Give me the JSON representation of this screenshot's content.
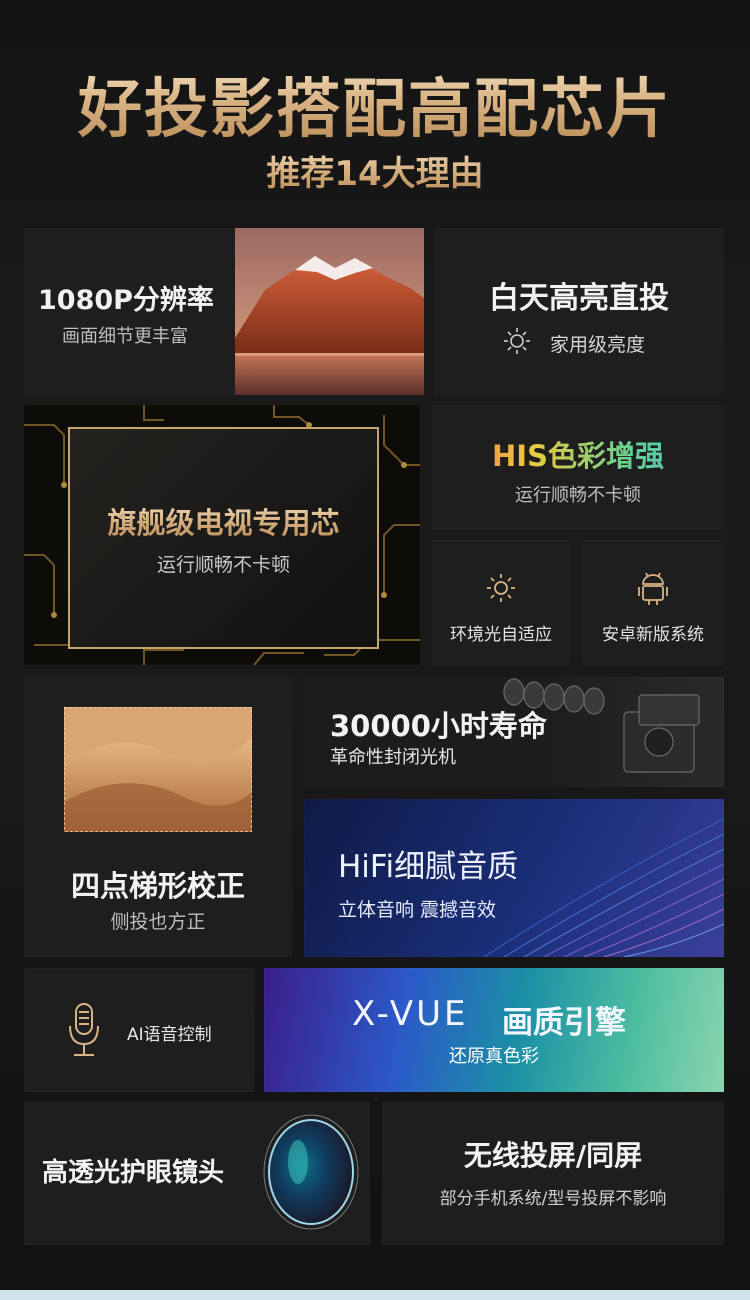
{
  "header": {
    "title": "好投影搭配高配芯片",
    "subtitle": "推荐14大理由"
  },
  "features": {
    "resolution": {
      "title": "1080P分辨率",
      "desc": "画面细节更丰富"
    },
    "brightness": {
      "title": "白天高亮直投",
      "desc": "家用级亮度"
    },
    "chip": {
      "title": "旗舰级电视专用芯",
      "desc": "运行顺畅不卡顿"
    },
    "his": {
      "title": "HIS色彩增强",
      "desc": "运行顺畅不卡顿"
    },
    "ambient": {
      "title": "环境光自适应"
    },
    "android": {
      "title": "安卓新版系统"
    },
    "life": {
      "title": "30000小时寿命",
      "desc": "革命性封闭光机"
    },
    "keystone": {
      "title": "四点梯形校正",
      "desc": "侧投也方正"
    },
    "hifi": {
      "title": "HiFi细腻音质",
      "desc": "立体音响 震撼音效"
    },
    "ai_voice": {
      "title": "AI语音控制"
    },
    "xvue": {
      "brand": "X-VUE",
      "title": "画质引擎",
      "desc": "还原真色彩"
    },
    "lens": {
      "title": "高透光护眼镜头"
    },
    "cast": {
      "title": "无线投屏/同屏",
      "desc": "部分手机系统/型号投屏不影响"
    }
  },
  "colors": {
    "gold": "#d9b485",
    "card": "#1e1e1e",
    "his_gradient": "#e9654a,#f0c93c,#67d38d,#4ab0e8"
  }
}
